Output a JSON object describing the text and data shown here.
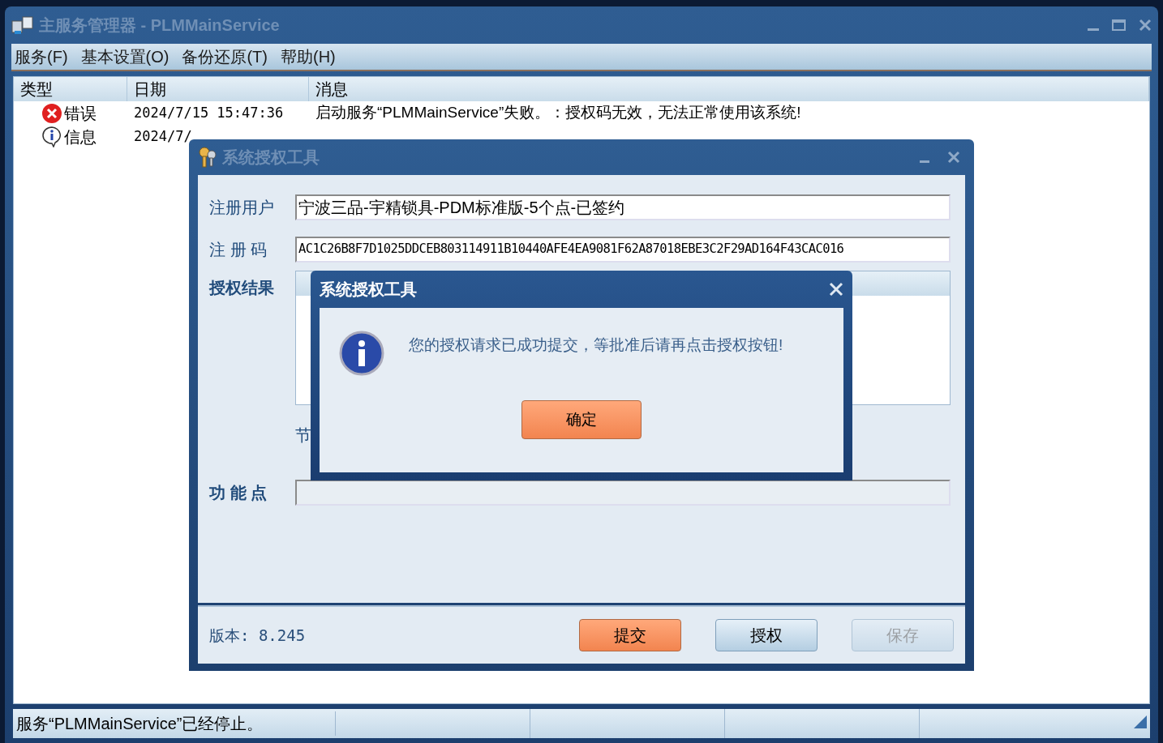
{
  "main_window": {
    "title": "主服务管理器 - PLMMainService",
    "menu": [
      "服务(F)",
      "基本设置(O)",
      "备份还原(T)",
      "帮助(H)"
    ],
    "log": {
      "columns": [
        "类型",
        "日期",
        "消息"
      ],
      "rows": [
        {
          "kind": "error",
          "type": "错误",
          "date": "2024/7/15 15:47:36",
          "message": "启动服务“PLMMainService”失败。：授权码无效，无法正常使用该系统!"
        },
        {
          "kind": "info",
          "type": "信息",
          "date": "2024/7/"
        }
      ]
    },
    "status_bar": [
      "服务“PLMMainService”已经停止。"
    ]
  },
  "auth_tool": {
    "title": "系统授权工具",
    "fields": [
      {
        "label": "注册用户",
        "value": "宁波三品-宇精锁具-PDM标准版-5个点-已签约"
      },
      {
        "label": "注 册 码",
        "value": "AC1C26B8F7D1025DDCEB803114911B10440AFE4EA9081F62A87018EBE3C2F29AD164F43CAC016"
      }
    ],
    "result_label": "授权结果",
    "node_label": "节",
    "function_label": "功 能 点",
    "version": "版本: 8.245",
    "buttons": [
      {
        "label": "提交",
        "kind": "primary",
        "disabled": false
      },
      {
        "label": "授权",
        "kind": "normal",
        "disabled": false
      },
      {
        "label": "保存",
        "kind": "normal",
        "disabled": true
      }
    ]
  },
  "message_box": {
    "title": "系统授权工具",
    "text": "您的授权请求已成功提交，等批准后请再点击授权按钮!",
    "ok": "确定"
  }
}
